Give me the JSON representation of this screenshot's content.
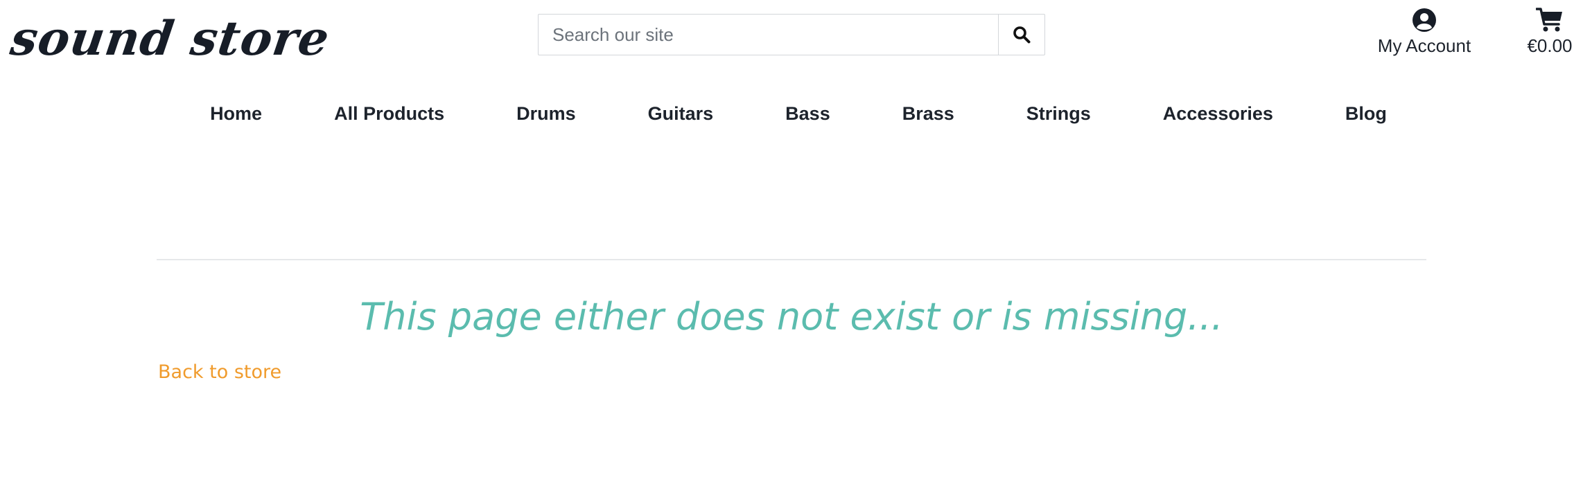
{
  "header": {
    "logo_text": "sound store",
    "search": {
      "placeholder": "Search our site",
      "button_icon": "search-icon"
    },
    "account": {
      "label": "My Account",
      "icon": "user-circle-icon"
    },
    "cart": {
      "amount": "€0.00",
      "icon": "shopping-cart-icon"
    }
  },
  "nav": {
    "items": [
      {
        "label": "Home"
      },
      {
        "label": "All Products"
      },
      {
        "label": "Drums"
      },
      {
        "label": "Guitars"
      },
      {
        "label": "Bass"
      },
      {
        "label": "Brass"
      },
      {
        "label": "Strings"
      },
      {
        "label": "Accessories"
      },
      {
        "label": "Blog"
      }
    ]
  },
  "main": {
    "error_message": "This page either does not exist or is missing...",
    "back_link": "Back to store"
  },
  "colors": {
    "text": "#1d232c",
    "error_text": "#5bbcae",
    "link": "#f09b2c",
    "divider": "#e6e8ea",
    "input_border": "#d3d6da"
  }
}
